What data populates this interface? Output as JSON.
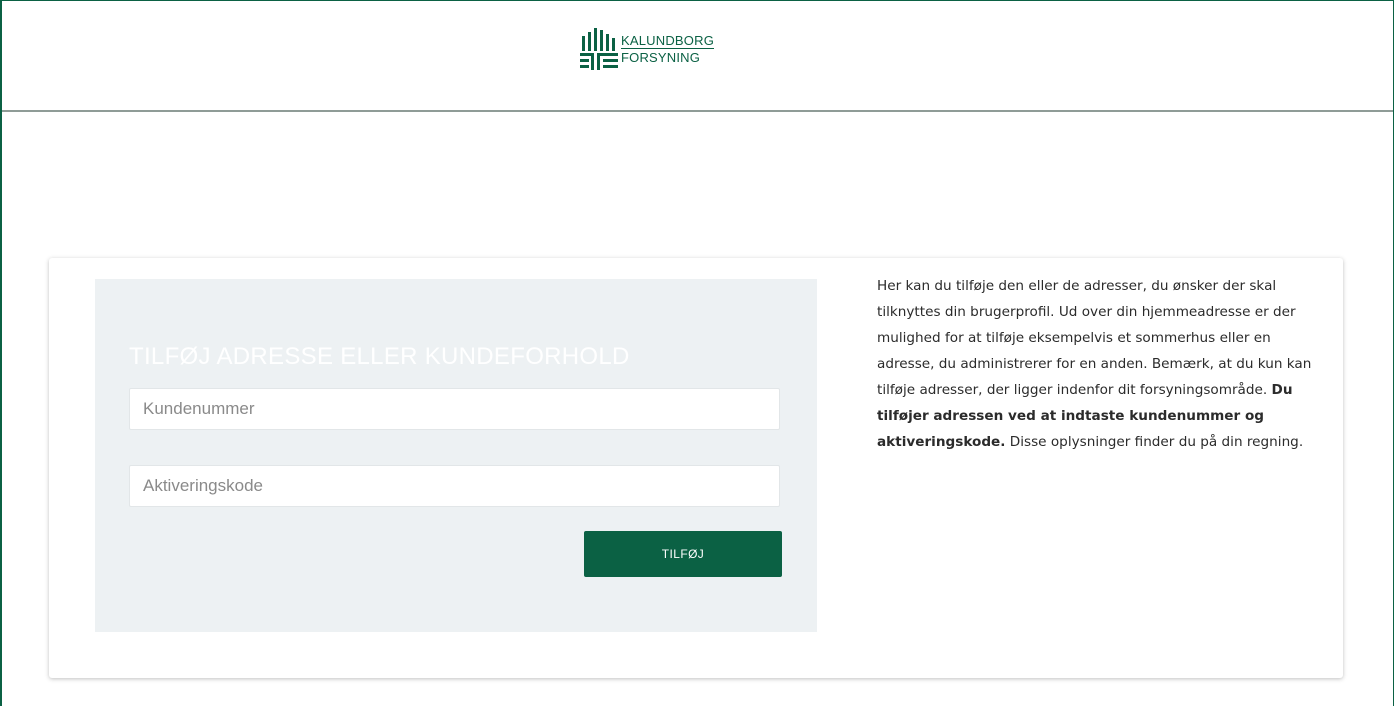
{
  "header": {
    "logo_line1": "KALUNDBORG",
    "logo_line2": "FORSYNING",
    "brand_color": "#0b6144"
  },
  "form": {
    "title": "TILFØJ ADRESSE ELLER KUNDEFORHOLD",
    "customer_number_placeholder": "Kundenummer",
    "customer_number_value": "",
    "activation_code_placeholder": "Aktiveringskode",
    "activation_code_value": "",
    "submit_label": "TILFØJ"
  },
  "info": {
    "text_part1": "Her kan du tilføje den eller de adresser, du ønsker der skal tilknyttes din brugerprofil. Ud over din hjemmeadresse er der mulighed for at tilføje eksempelvis et sommerhus eller en adresse, du administrerer for en anden.  Bemærk, at du kun kan tilføje adresser, der ligger indenfor dit forsyningsområde. ",
    "text_bold": "Du tilføjer adressen ved at indtaste kundenummer og aktiveringskode.",
    "text_part2": " Disse oplysninger finder du på din regning."
  }
}
